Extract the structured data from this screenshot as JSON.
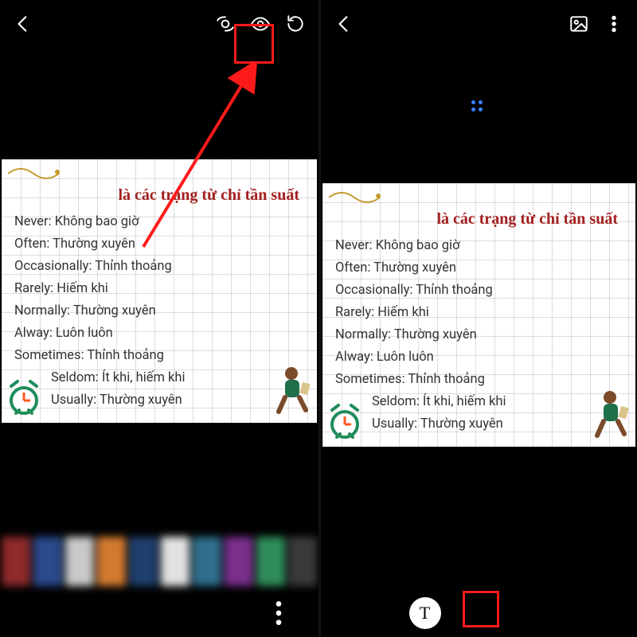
{
  "left": {
    "note": {
      "title": "là các trạng từ chỉ tần suất",
      "lines": [
        "Never: Không bao giờ",
        "Often: Thường xuyên",
        "Occasionally: Thỉnh thoảng",
        "Rarely: Hiếm khi",
        "Normally: Thường xuyên",
        "Alway: Luôn luôn",
        "Sometimes: Thỉnh thoảng",
        "Seldom: Ít khi, hiếm khi",
        "Usually: Thường xuyên"
      ]
    },
    "thumbs_colors": [
      "#8d2a2a",
      "#2a4a8d",
      "#c9c9c9",
      "#d37a2f",
      "#1f3f6f",
      "#e2e2e2",
      "#2f6f8d",
      "#7a2f8d",
      "#2f8d5a",
      "#3a3a3a"
    ]
  },
  "right": {
    "note": {
      "title": "là các trạng từ chỉ tần suất",
      "lines": [
        "Never: Không bao giờ",
        "Often: Thường xuyên",
        "Occasionally: Thỉnh thoảng",
        "Rarely: Hiếm khi",
        "Normally: Thường xuyên",
        "Alway: Luôn luôn",
        "Sometimes: Thỉnh thoảng",
        "Seldom: Ít khi, hiếm khi",
        "Usually: Thường xuyên"
      ]
    }
  },
  "icons": {
    "back": "back-icon",
    "bixby": "bixby-vision-icon",
    "eye": "eye-icon",
    "rotate": "rotate-icon",
    "gallery": "gallery-icon",
    "more": "more-icon",
    "heart": "heart-icon",
    "pencil": "pencil-icon",
    "share": "share-icon",
    "trash": "trash-icon",
    "text": "text-tool-icon",
    "search": "search-icon",
    "mic": "mic-icon"
  },
  "colors": {
    "highlight": "#ff1a1a",
    "title": "#a31f1f"
  },
  "text_tool_glyph": "T"
}
